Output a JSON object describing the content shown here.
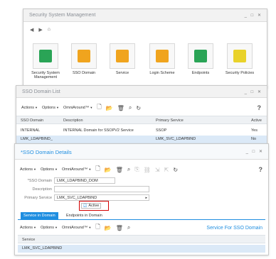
{
  "win1": {
    "title": "Security System Management",
    "tiles": [
      {
        "label": "Security System Management",
        "icon": "table-icon",
        "color": "#2aa456"
      },
      {
        "label": "SSO Domain",
        "icon": "list-icon",
        "color": "#f0a41e"
      },
      {
        "label": "Service",
        "icon": "list-icon",
        "color": "#f0a41e"
      },
      {
        "label": "Login Scheme",
        "icon": "list-icon",
        "color": "#f0a41e"
      },
      {
        "label": "Endpoints",
        "icon": "table-icon",
        "color": "#2aa456"
      },
      {
        "label": "Security Policies",
        "icon": "grid-icon",
        "color": "#e9d22a"
      }
    ]
  },
  "win2": {
    "title": "SSO Domain List",
    "toolbar": {
      "actions": "Actions",
      "options": "Options",
      "omni": "OmniAround™"
    },
    "columns": [
      "SSO Domain",
      "Description",
      "Primary Service",
      "Active"
    ],
    "rows": [
      [
        "INTERNAL",
        "INTERNAL Domain for SSOPV2 Service",
        "SSOP",
        "Yes"
      ],
      [
        "LMK_LDAPBIND_",
        "",
        "LMK_SVC_LDAPBIND",
        "No"
      ]
    ]
  },
  "win3": {
    "title": "*SSO Domain Details",
    "toolbar": {
      "actions": "Actions",
      "options": "Options",
      "omni": "OmniAround™"
    },
    "fields": {
      "sso_domain_label": "*SSO Domain",
      "sso_domain_value": "LMK_LDAPBIND_DOM",
      "description_label": "Description",
      "description_value": "",
      "primary_service_label": "Primary Service",
      "primary_service_value": "LMK_SVC_LDAPBIND",
      "active_label": "Active"
    },
    "tabs": [
      "Service in Domain",
      "Endpoints in Domain"
    ],
    "sub_toolbar": {
      "actions": "Actions",
      "options": "Options",
      "omni": "OmniAround™"
    },
    "sub_title": "Service For SSO Domain",
    "sub_columns": [
      "Service"
    ],
    "sub_rows": [
      "LMK_SVC_LDAPBIND"
    ]
  },
  "colors": {
    "accent": "#1f8ee0",
    "highlight": "#d30000",
    "selected_row": "#dbe9f7"
  }
}
